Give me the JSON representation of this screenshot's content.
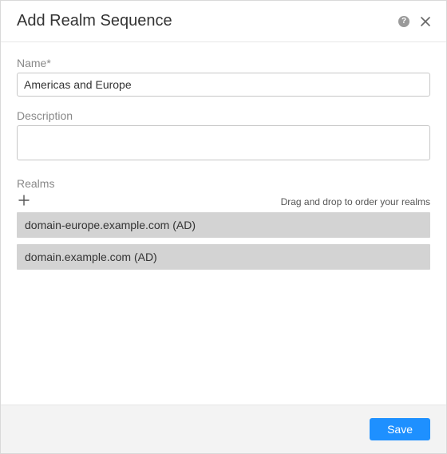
{
  "header": {
    "title": "Add Realm Sequence",
    "help_glyph": "?"
  },
  "form": {
    "name_label": "Name*",
    "name_value": "Americas and Europe",
    "description_label": "Description",
    "description_value": "",
    "realms_label": "Realms",
    "realms_hint": "Drag and drop to order your realms",
    "realms_items": [
      "domain-europe.example.com (AD)",
      "domain.example.com (AD)"
    ]
  },
  "footer": {
    "save_label": "Save"
  }
}
